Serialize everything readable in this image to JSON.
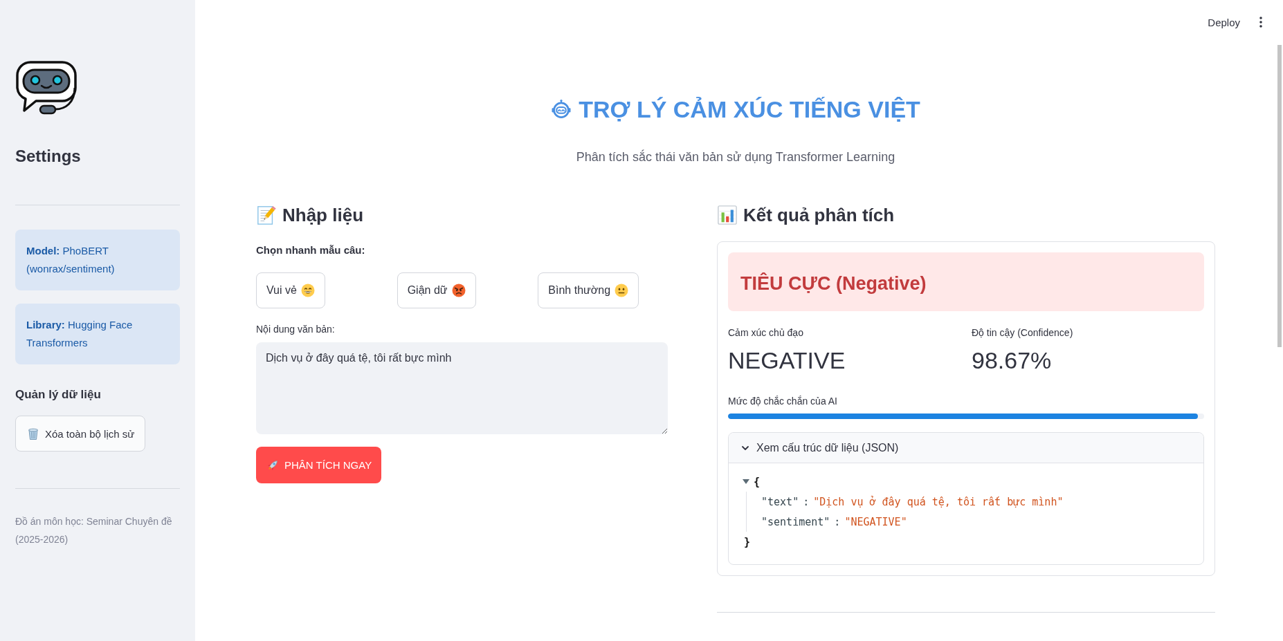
{
  "toolbar": {
    "deploy_label": "Deploy"
  },
  "sidebar": {
    "title": "Settings",
    "info_boxes": [
      "**Model:** PhoBERT (wonrax/sentiment)",
      "**Library:** Hugging Face Transformers"
    ],
    "section_title": "Quản lý dữ liệu",
    "clear_button": {
      "label": "Xóa toàn bộ lịch sử"
    },
    "footer": "Đồ án môn học: Seminar Chuyên đề (2025-2026)"
  },
  "header": {
    "title": "TRỢ LÝ CẢM XÚC TIẾNG VIỆT",
    "subtitle": "Phân tích sắc thái văn bản sử dụng Transformer Learning"
  },
  "input_panel": {
    "heading": "Nhập liệu",
    "samples_label": "Chọn nhanh mẫu câu:",
    "sample_buttons": [
      {
        "label": "Vui vẻ",
        "kind": "happy"
      },
      {
        "label": "Giận dữ",
        "kind": "angry"
      },
      {
        "label": "Bình thường",
        "kind": "neutral"
      }
    ],
    "text_label": "Nội dung văn bản:",
    "text_value": "Dịch vụ ở đây quá tệ, tôi rất bực mình",
    "analyze_button": "PHÂN TÍCH NGAY"
  },
  "result_panel": {
    "heading": "Kết quả phân tích",
    "verdict": {
      "text": "TIÊU CỰC (Negative)",
      "kind": "negative"
    },
    "metrics": [
      {
        "label": "Cảm xúc chủ đạo",
        "value": "NEGATIVE"
      },
      {
        "label": "Độ tin cậy (Confidence)",
        "value": "98.67%"
      }
    ],
    "confidence": {
      "label": "Mức độ chắc chắn của AI",
      "level": 0.9867
    },
    "details": {
      "label": "Xem cấu trúc dữ liệu (JSON)",
      "expanded": true,
      "tree": {
        "expanded": true,
        "open": "{",
        "close": "}",
        "entries": [
          {
            "key": "\"text\"",
            "separator": ":",
            "value": "\"Dịch vụ ở đây quá tệ, tôi rất bực mình\""
          },
          {
            "key": "\"sentiment\"",
            "separator": ":",
            "value": "\"NEGATIVE\""
          }
        ]
      }
    }
  }
}
